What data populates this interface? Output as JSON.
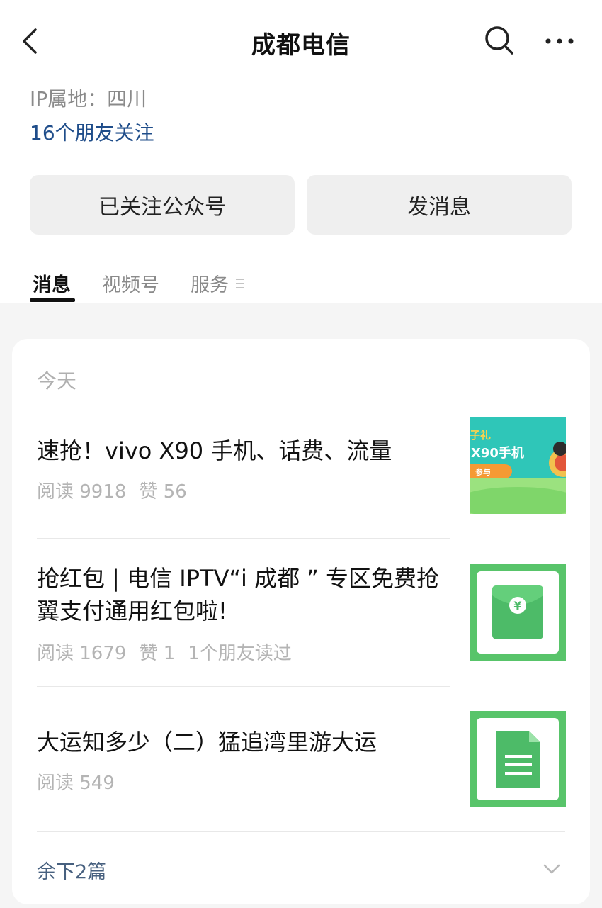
{
  "header": {
    "title": "成都电信",
    "back_icon": "chevron-left-icon",
    "search_icon": "search-icon",
    "more_icon": "more-dots-icon"
  },
  "profile": {
    "ip_location": "IP属地：四川",
    "friends_following": "16个朋友关注"
  },
  "actions": {
    "follow_label": "已关注公众号",
    "message_label": "发消息"
  },
  "tabs": [
    {
      "label": "消息",
      "active": true
    },
    {
      "label": "视频号",
      "active": false
    },
    {
      "label": "服务",
      "active": false
    }
  ],
  "feed": {
    "date_label": "今天",
    "articles": [
      {
        "title": "速抢！vivo X90 手机、话费、流量",
        "reads": "阅读 9918",
        "likes": "赞 56",
        "friends_read": "",
        "thumbnail": {
          "overlay_text": "X90手机",
          "corner_text": "子礼",
          "small_text": "参与",
          "colors": [
            "#2fc6b8",
            "#9be27f"
          ]
        }
      },
      {
        "title": "抢红包 | 电信 IPTV“i 成都 ” 专区免费抢翼支付通用红包啦!",
        "reads": "阅读 1679",
        "likes": "赞 1",
        "friends_read": "1个朋友读过",
        "thumbnail": {
          "icon": "red-envelope-icon",
          "colors": [
            "#58c46a",
            "#4dbb68"
          ]
        }
      },
      {
        "title": "大运知多少（二）猛追湾里游大运",
        "reads": "阅读 549",
        "likes": "",
        "friends_read": "",
        "thumbnail": {
          "icon": "document-icon",
          "colors": [
            "#58c46a",
            "#4dbb68"
          ]
        }
      }
    ],
    "remaining_label": "余下2篇"
  },
  "colors": {
    "link_blue": "#1f4d8a",
    "button_gray": "#efefef",
    "background": "#f5f5f5",
    "thumb_green": "#58c46a"
  }
}
